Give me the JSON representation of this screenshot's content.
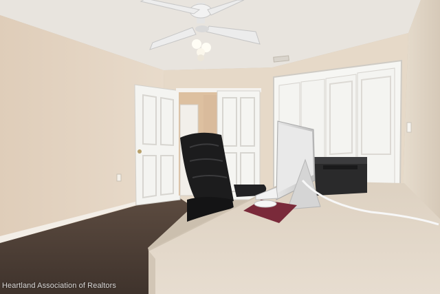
{
  "photo": {
    "watermark": "Heartland Association of Realtors"
  },
  "colors": {
    "wall": "#e6d8c7",
    "ceiling": "#e9e5df",
    "carpet": "#4e3f36",
    "door": "#f4f4f1",
    "desk": "#e3d8c9",
    "chair": "#1c1c1d"
  },
  "objects": [
    "ceiling-fan",
    "office-chair",
    "imac-computer",
    "laser-printer",
    "keyboard",
    "mouse",
    "mouse-pad",
    "closet-doors",
    "bedroom-door"
  ]
}
